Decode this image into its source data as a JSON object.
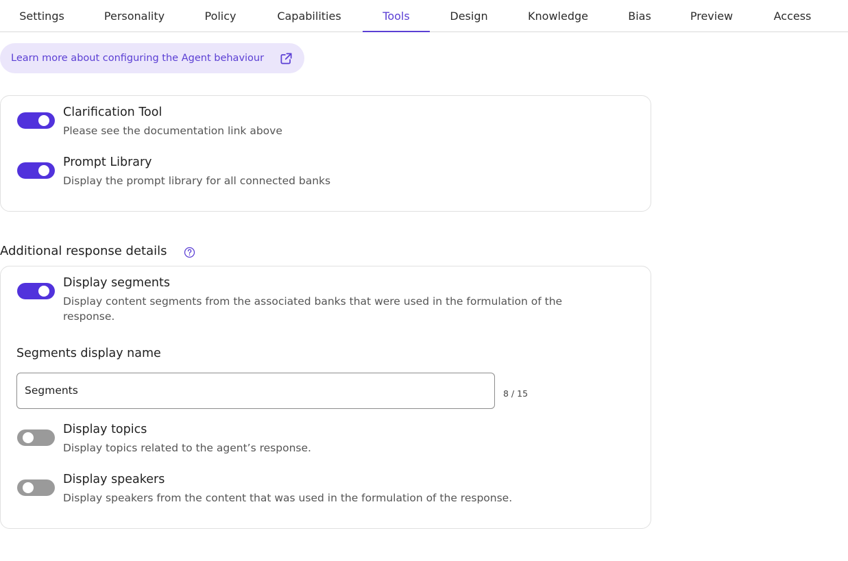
{
  "tabs": [
    {
      "label": "Settings"
    },
    {
      "label": "Personality"
    },
    {
      "label": "Policy"
    },
    {
      "label": "Capabilities"
    },
    {
      "label": "Tools",
      "active": true
    },
    {
      "label": "Design"
    },
    {
      "label": "Knowledge"
    },
    {
      "label": "Bias"
    },
    {
      "label": "Preview"
    },
    {
      "label": "Access"
    }
  ],
  "learn_more": {
    "label": "Learn more about configuring the Agent behaviour",
    "icon": "external-link-icon"
  },
  "tools": [
    {
      "title": "Clarification Tool",
      "description": "Please see the documentation link above",
      "enabled": true
    },
    {
      "title": "Prompt Library",
      "description": "Display the prompt library for all connected banks",
      "enabled": true
    }
  ],
  "additional": {
    "title": "Additional response details",
    "help_icon": "question-circle-icon",
    "segments": {
      "title": "Display segments",
      "description": "Display content segments from the associated banks that were used in the formulation of the response.",
      "enabled": true
    },
    "segments_name": {
      "label": "Segments display name",
      "value": "Segments",
      "counter": "8 / 15"
    },
    "topics": {
      "title": "Display topics",
      "description": "Display topics related to the agent’s response.",
      "enabled": false
    },
    "speakers": {
      "title": "Display speakers",
      "description": "Display speakers from the content that was used in the formulation of the response.",
      "enabled": false
    }
  },
  "colors": {
    "accent": "#5b3fd4",
    "toggle_on": "#5132dc",
    "toggle_off": "#9a9a9a",
    "pill_bg": "#ebe6fb"
  }
}
